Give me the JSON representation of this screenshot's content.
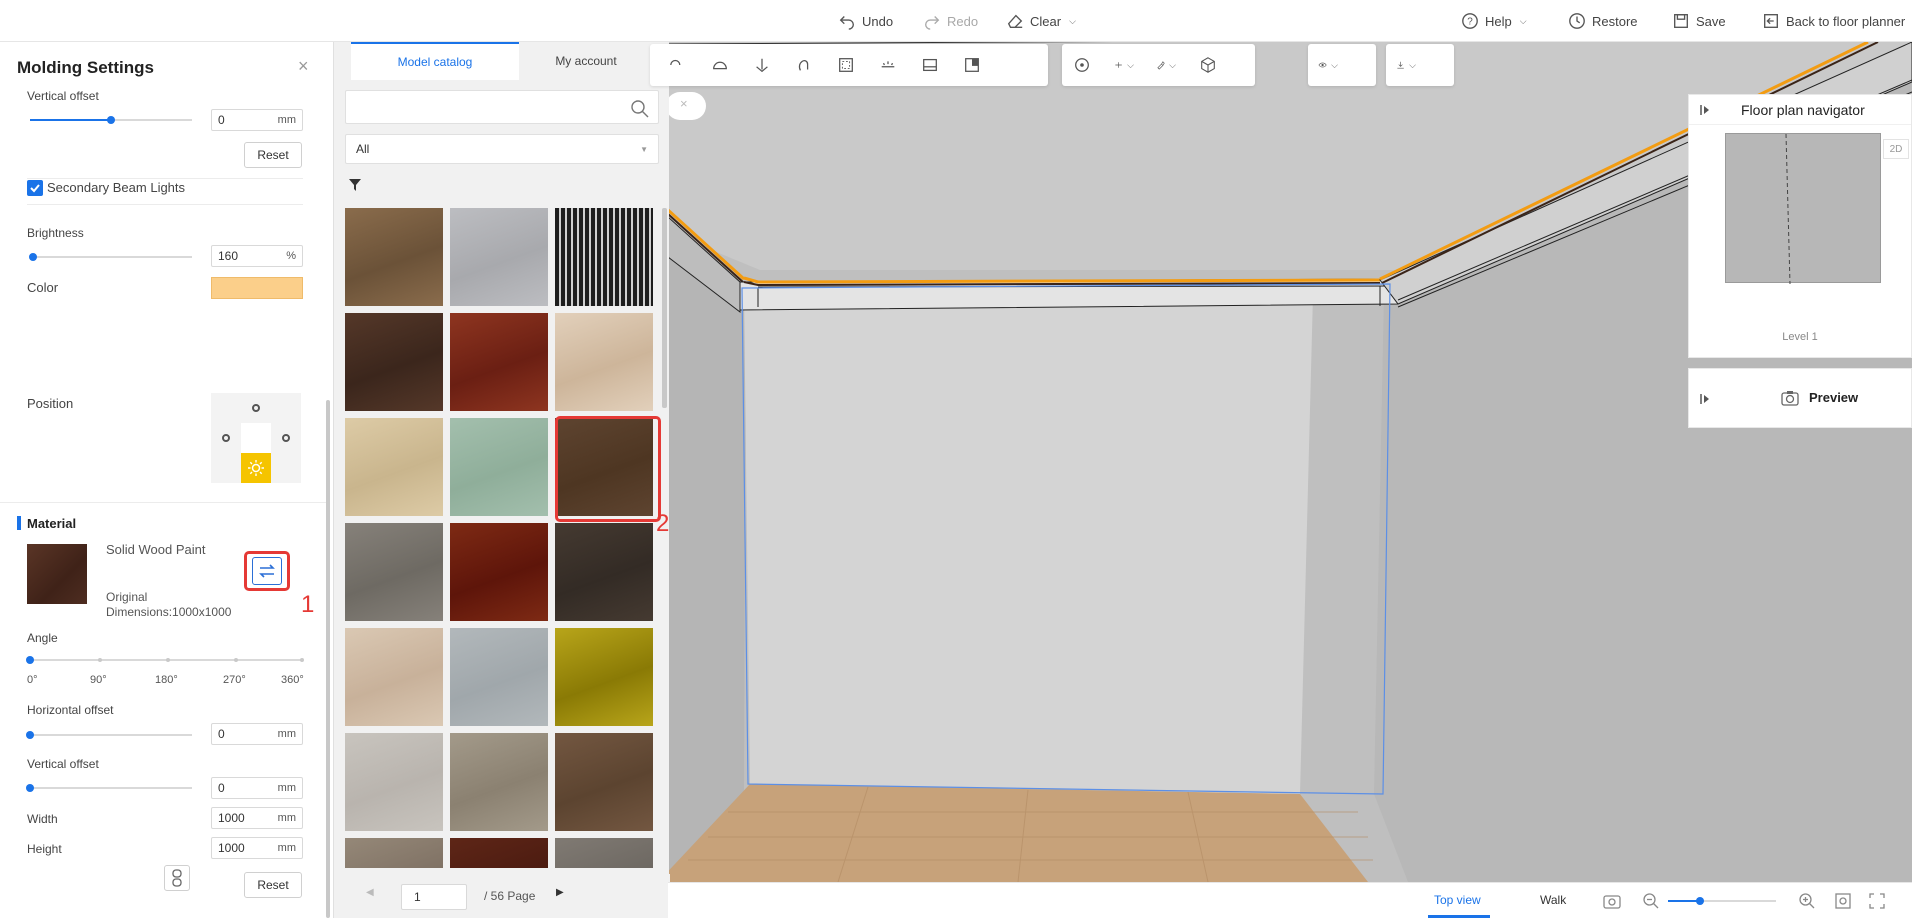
{
  "toolbar": {
    "undo": "Undo",
    "redo": "Redo",
    "clear": "Clear",
    "help": "Help",
    "restore": "Restore",
    "save": "Save",
    "back": "Back to floor planner"
  },
  "molding": {
    "title": "Molding Settings",
    "vertical_offset_top": {
      "label": "Vertical offset",
      "value": "0",
      "unit": "mm",
      "level": 0.5
    },
    "reset_top": "Reset",
    "secondary_beam": {
      "label": "Secondary Beam Lights",
      "checked": true
    },
    "brightness": {
      "label": "Brightness",
      "value": "160",
      "unit": "%",
      "level": 0.02
    },
    "color": {
      "label": "Color",
      "value": "#fbcf8a"
    },
    "position": {
      "label": "Position",
      "selected": "bottom-center"
    }
  },
  "material": {
    "section_title": "Material",
    "name": "Solid Wood Paint",
    "dims_label": "Original",
    "dims_value": "Dimensions:1000x1000",
    "angle": {
      "label": "Angle",
      "ticks": [
        "0°",
        "90°",
        "180°",
        "270°",
        "360°"
      ],
      "level": 0
    },
    "horizontal_offset": {
      "label": "Horizontal offset",
      "value": "0",
      "unit": "mm",
      "level": 0
    },
    "vertical_offset": {
      "label": "Vertical offset",
      "value": "0",
      "unit": "mm",
      "level": 0
    },
    "width": {
      "label": "Width",
      "value": "1000",
      "unit": "mm"
    },
    "height": {
      "label": "Height",
      "value": "1000",
      "unit": "mm"
    },
    "reset": "Reset"
  },
  "annotations": {
    "one": "1",
    "two": "2"
  },
  "catalog": {
    "tabs": [
      "Model catalog",
      "My account"
    ],
    "search_placeholder": "",
    "filter_value": "All",
    "page_value": "1",
    "page_total": "/ 56 Page",
    "tiles": [
      {
        "color": "#6b5238",
        "color2": "#8a6c4c"
      },
      {
        "color": "#a8a9ad",
        "color2": "#bcbdc1"
      },
      {
        "color": "#1d1d1d",
        "color2": "#cfcfcf",
        "pattern": "stripes"
      },
      {
        "color": "#3b261c",
        "color2": "#553829"
      },
      {
        "color": "#6b1f13",
        "color2": "#8e3520"
      },
      {
        "color": "#cdb59a",
        "color2": "#e2d0bb"
      },
      {
        "color": "#c9b58d",
        "color2": "#ddcba6"
      },
      {
        "color": "#8fae9a",
        "color2": "#a3bfad"
      },
      {
        "color": "#4e3622",
        "color2": "#5e4430",
        "selected": true
      },
      {
        "color": "#6e6a63",
        "color2": "#86817a"
      },
      {
        "color": "#5e150a",
        "color2": "#7e2a14"
      },
      {
        "color": "#332b25",
        "color2": "#453a31"
      },
      {
        "color": "#c8b19a",
        "color2": "#dac8b3"
      },
      {
        "color": "#a0a7ab",
        "color2": "#b2b8bb"
      },
      {
        "color": "#8a7a05",
        "color2": "#b8a51a"
      },
      {
        "color": "#b9b4ae",
        "color2": "#c8c4be"
      },
      {
        "color": "#8b8171",
        "color2": "#a39a8a"
      },
      {
        "color": "#5c4430",
        "color2": "#735741"
      },
      {
        "color": "#7d6f62",
        "color2": "#958878"
      },
      {
        "color": "#4a1a10",
        "color2": "#5e2617"
      },
      {
        "color": "#6b6660",
        "color2": "#807a73"
      }
    ]
  },
  "navigator": {
    "title": "Floor plan navigator",
    "mode": "2D",
    "level": "Level 1"
  },
  "preview": {
    "label": "Preview"
  },
  "bottom": {
    "top_view": "Top view",
    "walk": "Walk",
    "zoom_level": 0.3
  }
}
